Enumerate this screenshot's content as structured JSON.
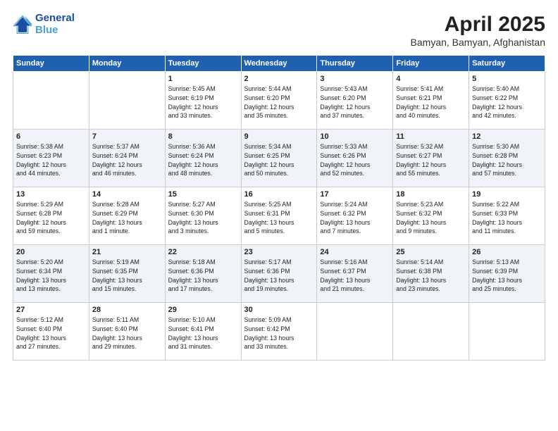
{
  "header": {
    "logo_line1": "General",
    "logo_line2": "Blue",
    "month": "April 2025",
    "location": "Bamyan, Bamyan, Afghanistan"
  },
  "weekdays": [
    "Sunday",
    "Monday",
    "Tuesday",
    "Wednesday",
    "Thursday",
    "Friday",
    "Saturday"
  ],
  "weeks": [
    [
      {
        "day": "",
        "info": ""
      },
      {
        "day": "",
        "info": ""
      },
      {
        "day": "1",
        "info": "Sunrise: 5:45 AM\nSunset: 6:19 PM\nDaylight: 12 hours\nand 33 minutes."
      },
      {
        "day": "2",
        "info": "Sunrise: 5:44 AM\nSunset: 6:20 PM\nDaylight: 12 hours\nand 35 minutes."
      },
      {
        "day": "3",
        "info": "Sunrise: 5:43 AM\nSunset: 6:20 PM\nDaylight: 12 hours\nand 37 minutes."
      },
      {
        "day": "4",
        "info": "Sunrise: 5:41 AM\nSunset: 6:21 PM\nDaylight: 12 hours\nand 40 minutes."
      },
      {
        "day": "5",
        "info": "Sunrise: 5:40 AM\nSunset: 6:22 PM\nDaylight: 12 hours\nand 42 minutes."
      }
    ],
    [
      {
        "day": "6",
        "info": "Sunrise: 5:38 AM\nSunset: 6:23 PM\nDaylight: 12 hours\nand 44 minutes."
      },
      {
        "day": "7",
        "info": "Sunrise: 5:37 AM\nSunset: 6:24 PM\nDaylight: 12 hours\nand 46 minutes."
      },
      {
        "day": "8",
        "info": "Sunrise: 5:36 AM\nSunset: 6:24 PM\nDaylight: 12 hours\nand 48 minutes."
      },
      {
        "day": "9",
        "info": "Sunrise: 5:34 AM\nSunset: 6:25 PM\nDaylight: 12 hours\nand 50 minutes."
      },
      {
        "day": "10",
        "info": "Sunrise: 5:33 AM\nSunset: 6:26 PM\nDaylight: 12 hours\nand 52 minutes."
      },
      {
        "day": "11",
        "info": "Sunrise: 5:32 AM\nSunset: 6:27 PM\nDaylight: 12 hours\nand 55 minutes."
      },
      {
        "day": "12",
        "info": "Sunrise: 5:30 AM\nSunset: 6:28 PM\nDaylight: 12 hours\nand 57 minutes."
      }
    ],
    [
      {
        "day": "13",
        "info": "Sunrise: 5:29 AM\nSunset: 6:28 PM\nDaylight: 12 hours\nand 59 minutes."
      },
      {
        "day": "14",
        "info": "Sunrise: 5:28 AM\nSunset: 6:29 PM\nDaylight: 13 hours\nand 1 minute."
      },
      {
        "day": "15",
        "info": "Sunrise: 5:27 AM\nSunset: 6:30 PM\nDaylight: 13 hours\nand 3 minutes."
      },
      {
        "day": "16",
        "info": "Sunrise: 5:25 AM\nSunset: 6:31 PM\nDaylight: 13 hours\nand 5 minutes."
      },
      {
        "day": "17",
        "info": "Sunrise: 5:24 AM\nSunset: 6:32 PM\nDaylight: 13 hours\nand 7 minutes."
      },
      {
        "day": "18",
        "info": "Sunrise: 5:23 AM\nSunset: 6:32 PM\nDaylight: 13 hours\nand 9 minutes."
      },
      {
        "day": "19",
        "info": "Sunrise: 5:22 AM\nSunset: 6:33 PM\nDaylight: 13 hours\nand 11 minutes."
      }
    ],
    [
      {
        "day": "20",
        "info": "Sunrise: 5:20 AM\nSunset: 6:34 PM\nDaylight: 13 hours\nand 13 minutes."
      },
      {
        "day": "21",
        "info": "Sunrise: 5:19 AM\nSunset: 6:35 PM\nDaylight: 13 hours\nand 15 minutes."
      },
      {
        "day": "22",
        "info": "Sunrise: 5:18 AM\nSunset: 6:36 PM\nDaylight: 13 hours\nand 17 minutes."
      },
      {
        "day": "23",
        "info": "Sunrise: 5:17 AM\nSunset: 6:36 PM\nDaylight: 13 hours\nand 19 minutes."
      },
      {
        "day": "24",
        "info": "Sunrise: 5:16 AM\nSunset: 6:37 PM\nDaylight: 13 hours\nand 21 minutes."
      },
      {
        "day": "25",
        "info": "Sunrise: 5:14 AM\nSunset: 6:38 PM\nDaylight: 13 hours\nand 23 minutes."
      },
      {
        "day": "26",
        "info": "Sunrise: 5:13 AM\nSunset: 6:39 PM\nDaylight: 13 hours\nand 25 minutes."
      }
    ],
    [
      {
        "day": "27",
        "info": "Sunrise: 5:12 AM\nSunset: 6:40 PM\nDaylight: 13 hours\nand 27 minutes."
      },
      {
        "day": "28",
        "info": "Sunrise: 5:11 AM\nSunset: 6:40 PM\nDaylight: 13 hours\nand 29 minutes."
      },
      {
        "day": "29",
        "info": "Sunrise: 5:10 AM\nSunset: 6:41 PM\nDaylight: 13 hours\nand 31 minutes."
      },
      {
        "day": "30",
        "info": "Sunrise: 5:09 AM\nSunset: 6:42 PM\nDaylight: 13 hours\nand 33 minutes."
      },
      {
        "day": "",
        "info": ""
      },
      {
        "day": "",
        "info": ""
      },
      {
        "day": "",
        "info": ""
      }
    ]
  ]
}
